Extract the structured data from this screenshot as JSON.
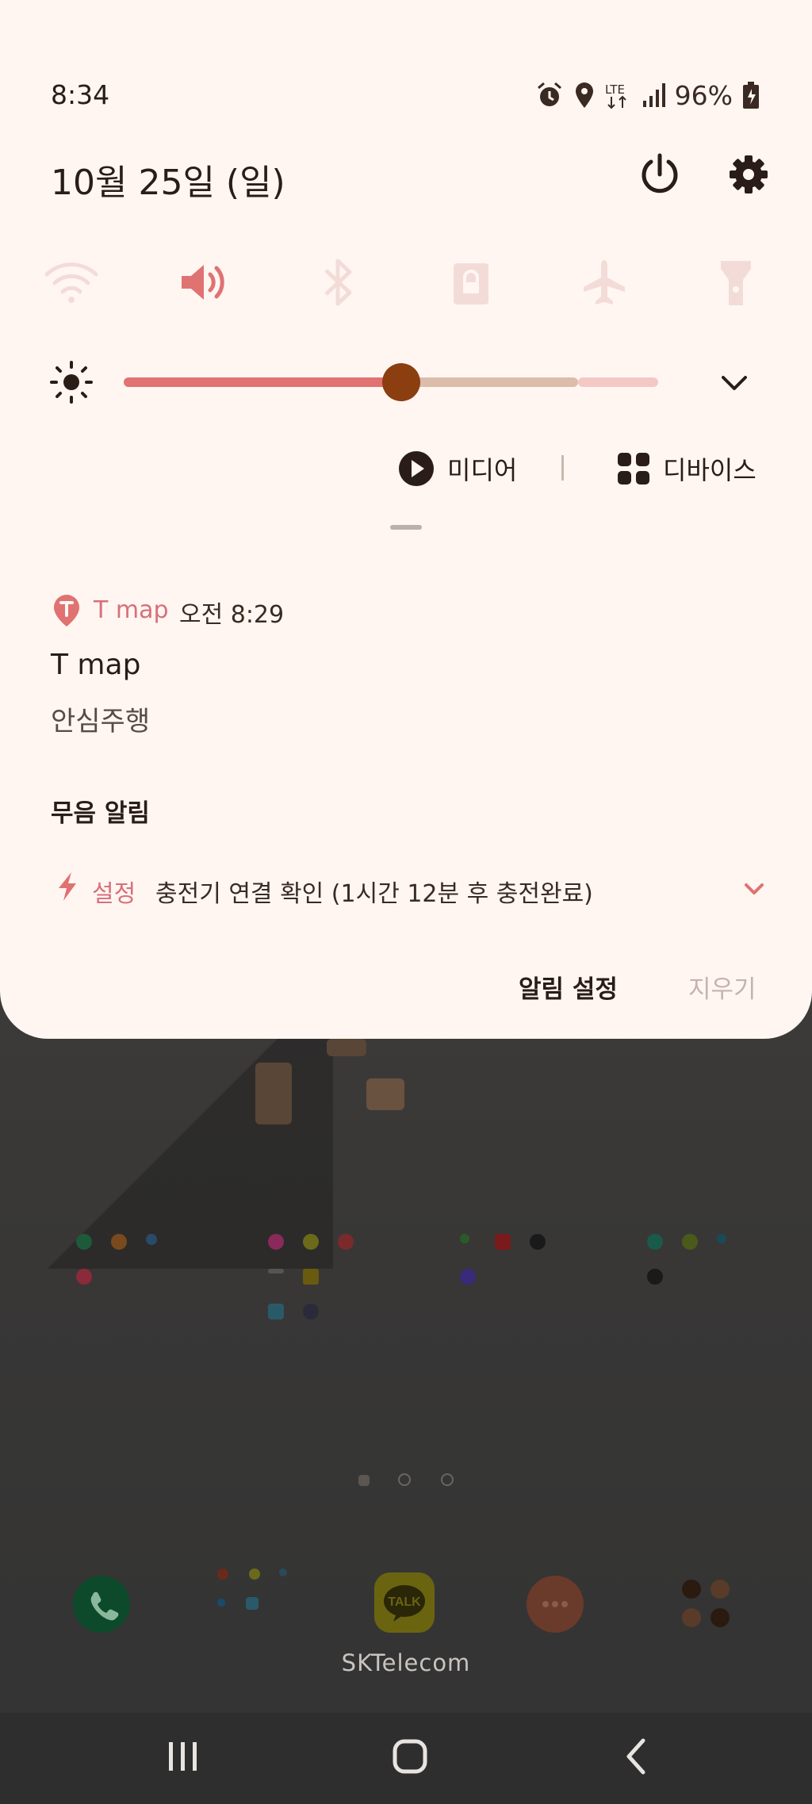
{
  "status_bar": {
    "time": "8:34",
    "battery": "96%",
    "icons": [
      "alarm-icon",
      "location-icon",
      "lte-icon",
      "signal-icon",
      "battery-icon"
    ]
  },
  "panel": {
    "date": "10월 25일 (일)",
    "header_icons": [
      "power-icon",
      "settings-icon"
    ],
    "quick_settings": [
      {
        "name": "wifi",
        "active": false
      },
      {
        "name": "sound",
        "active": true
      },
      {
        "name": "bluetooth",
        "active": false
      },
      {
        "name": "screen-lock",
        "active": false
      },
      {
        "name": "airplane-mode",
        "active": false
      },
      {
        "name": "flashlight",
        "active": false
      }
    ],
    "brightness": {
      "level": 0.52
    },
    "media_label": "미디어",
    "devices_label": "디바이스"
  },
  "notifications": {
    "tmap": {
      "app": "T map",
      "time": "오전 8:29",
      "title": "T map",
      "text": "안심주행"
    },
    "silent_header": "무음 알림",
    "charging": {
      "app": "설정",
      "text": "충전기 연결 확인 (1시간 12분 후 충전완료)"
    },
    "settings_button": "알림 설정",
    "clear_button": "지우기"
  },
  "home": {
    "carrier": "SKTelecom",
    "dock": [
      "phone-app-icon",
      "app-folder-icon",
      "kakaotalk-icon",
      "messages-icon",
      "apps-drawer-icon"
    ],
    "kakao_label": "TALK"
  },
  "colors": {
    "accent": "#e07272",
    "knob": "#8b3e10",
    "panel_bg": "#fff6f2",
    "text_dark": "#2a1c16"
  }
}
